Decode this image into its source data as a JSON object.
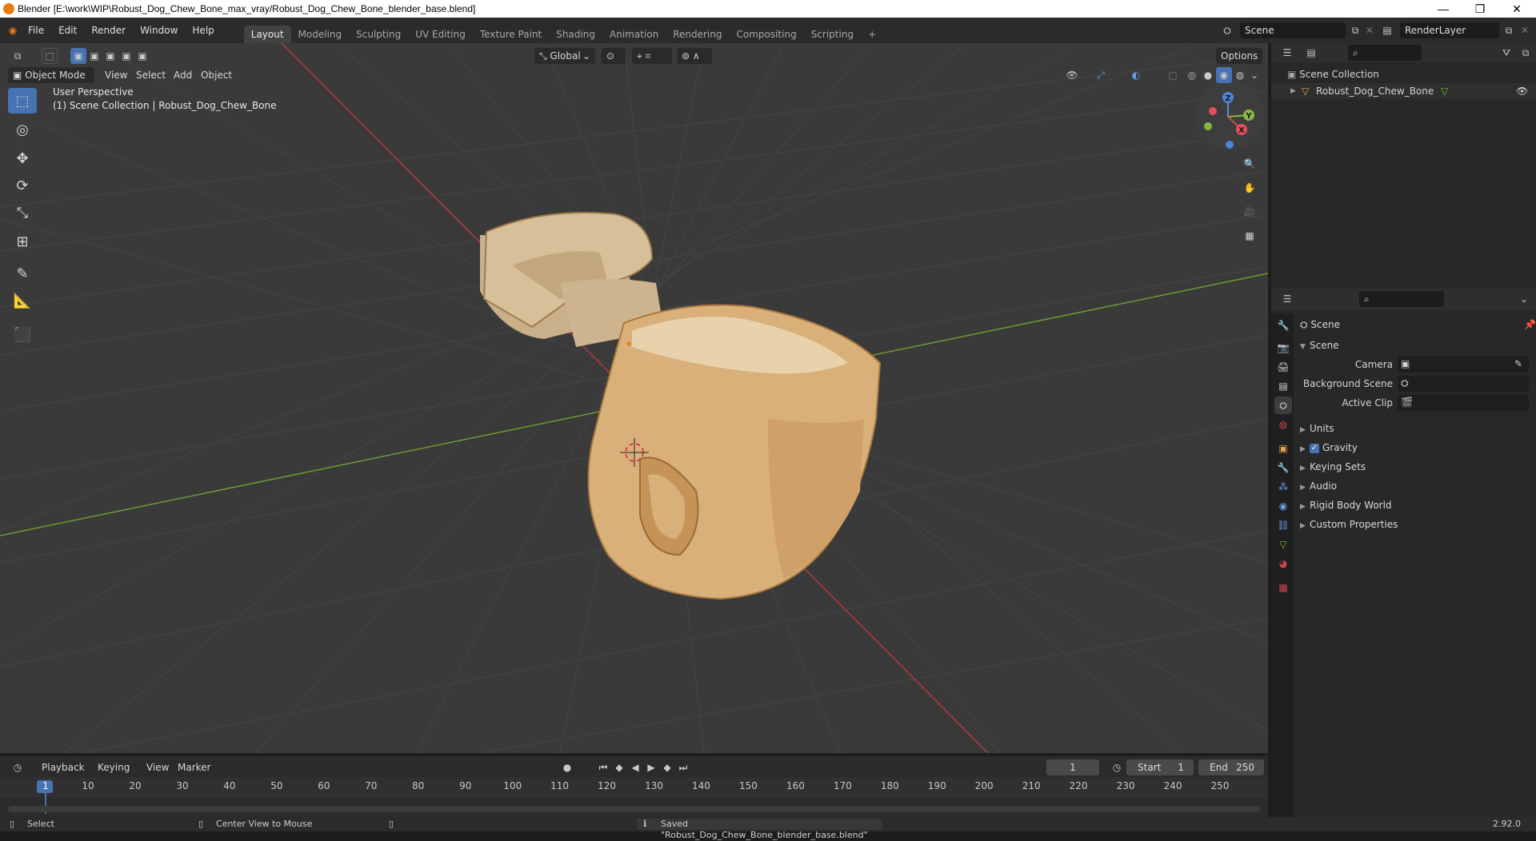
{
  "window": {
    "title": "Blender [E:\\work\\WIP\\Robust_Dog_Chew_Bone_max_vray/Robust_Dog_Chew_Bone_blender_base.blend]",
    "minimize": "—",
    "restore": "❐",
    "close": "✕"
  },
  "menubar": {
    "menus": [
      "File",
      "Edit",
      "Render",
      "Window",
      "Help"
    ],
    "workspaces": [
      "Layout",
      "Modeling",
      "Sculpting",
      "UV Editing",
      "Texture Paint",
      "Shading",
      "Animation",
      "Rendering",
      "Compositing",
      "Scripting"
    ],
    "active_workspace": "Layout",
    "add_workspace": "+",
    "scene_field": "Scene",
    "renderlayer_field": "RenderLayer"
  },
  "viewport": {
    "transform_orientation": "Global",
    "options_label": "Options",
    "mode": "Object Mode",
    "menus": [
      "View",
      "Select",
      "Add",
      "Object"
    ],
    "overlay_text_line1": "User Perspective",
    "overlay_text_line2": "(1) Scene Collection | Robust_Dog_Chew_Bone",
    "gizmo_axes": {
      "x": "X",
      "y": "Y",
      "z": "Z"
    },
    "colors": {
      "background": "#3a3a3a",
      "grid": "#454545",
      "x_axis": "#b33a3a",
      "y_axis": "#6f9a34",
      "active_tool": "#4772b3"
    }
  },
  "outliner": {
    "root": "Scene Collection",
    "items": [
      {
        "label": "Robust_Dog_Chew_Bone"
      }
    ]
  },
  "properties": {
    "context_label": "Scene",
    "panel_title": "Scene",
    "fields": [
      {
        "label": "Camera"
      },
      {
        "label": "Background Scene"
      },
      {
        "label": "Active Clip"
      }
    ],
    "subpanels": [
      "Units",
      "Gravity",
      "Keying Sets",
      "Audio",
      "Rigid Body World",
      "Custom Properties"
    ],
    "gravity_checked": true
  },
  "timeline": {
    "menus": [
      "Playback",
      "Keying",
      "View",
      "Marker"
    ],
    "current_frame": "1",
    "start_label": "Start",
    "start_value": "1",
    "end_label": "End",
    "end_value": "250",
    "ruler": [
      "1",
      "10",
      "20",
      "30",
      "40",
      "50",
      "60",
      "70",
      "80",
      "90",
      "100",
      "110",
      "120",
      "130",
      "140",
      "150",
      "160",
      "170",
      "180",
      "190",
      "200",
      "210",
      "220",
      "230",
      "240",
      "250"
    ]
  },
  "statusbar": {
    "select_hint": "Select",
    "center_hint": "Center View to Mouse",
    "message": "Saved \"Robust_Dog_Chew_Bone_blender_base.blend\"",
    "version": "2.92.0"
  }
}
